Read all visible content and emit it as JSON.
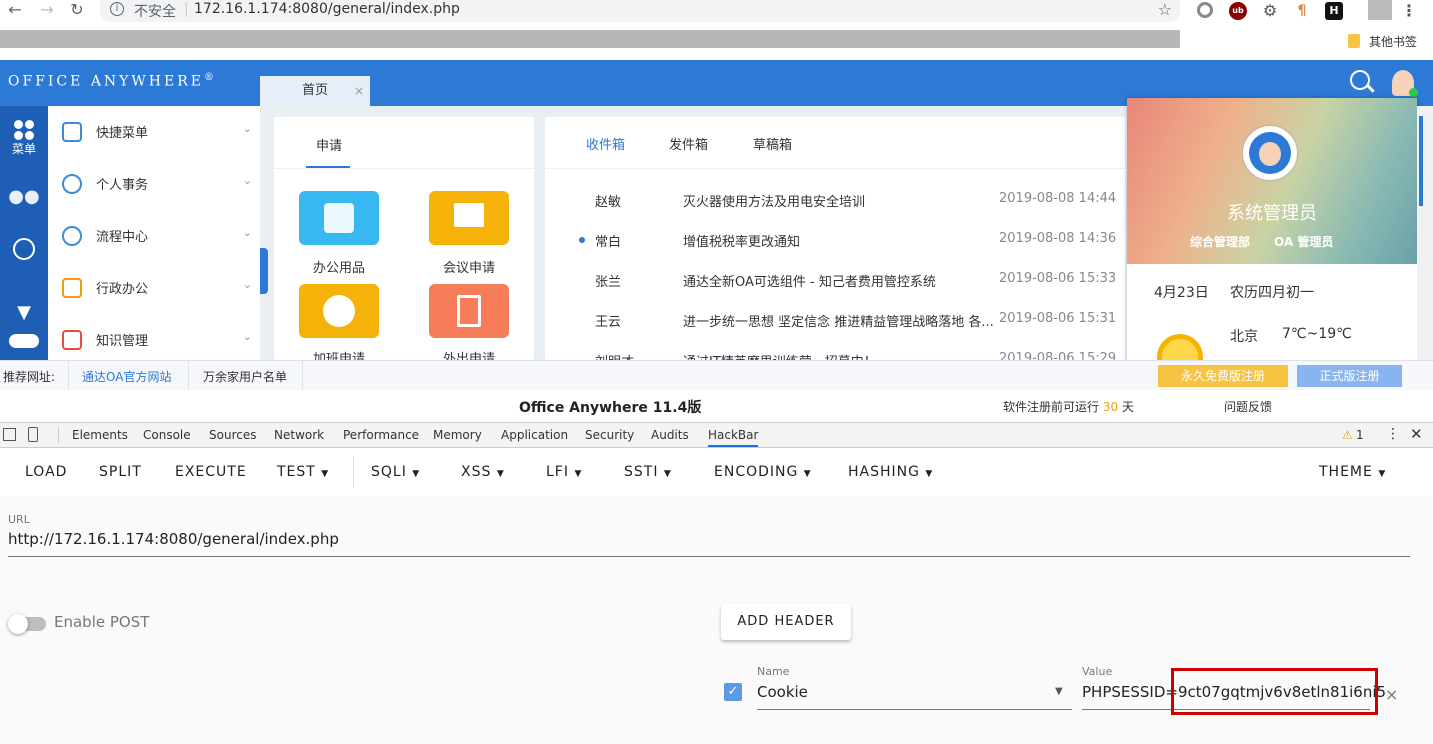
{
  "browser": {
    "url_security": "不安全",
    "url": "172.16.1.174:8080/general/index.php",
    "bookmark_other": "其他书签"
  },
  "oa": {
    "logo": "Office Anywhere",
    "logo_mark": "®",
    "tabs": [
      {
        "label": "首页"
      }
    ],
    "rail": [
      {
        "label": "菜单"
      }
    ],
    "menu": [
      {
        "label": "快捷菜单"
      },
      {
        "label": "个人事务"
      },
      {
        "label": "流程中心"
      },
      {
        "label": "行政办公"
      },
      {
        "label": "知识管理"
      }
    ],
    "apply_panel": {
      "tab": "申请",
      "apps": [
        {
          "label": "办公用品",
          "color": "#37b8f0"
        },
        {
          "label": "会议申请",
          "color": "#f5b30a"
        },
        {
          "label": "加班申请",
          "color": "#f5b30a"
        },
        {
          "label": "外出申请",
          "color": "#f77d5a"
        }
      ]
    },
    "mail_panel": {
      "tabs": [
        "收件箱",
        "发件箱",
        "草稿箱"
      ],
      "rows": [
        {
          "sender": "赵敏",
          "subject": "灭火器使用方法及用电安全培训",
          "time": "2019-08-08 14:44",
          "unread": false
        },
        {
          "sender": "常白",
          "subject": "增值税税率更改通知",
          "time": "2019-08-08 14:36",
          "unread": true
        },
        {
          "sender": "张兰",
          "subject": "通达全新OA可选组件 - 知己者费用管控系统",
          "time": "2019-08-06 15:33",
          "unread": false
        },
        {
          "sender": "王云",
          "subject": "进一步统一思想 坚定信念 推进精益管理战略落地 各...",
          "time": "2019-08-06 15:31",
          "unread": false
        },
        {
          "sender": "刘明才",
          "subject": "通过IT精英磨思训练营，招募中！",
          "time": "2019-08-06 15:29",
          "unread": false
        }
      ]
    },
    "profile": {
      "name": "系统管理员",
      "dept": "综合管理部",
      "role": "OA 管理员",
      "date": "4月23日",
      "lunar": "农历四月初一",
      "city": "北京",
      "temp": "7℃~19℃"
    },
    "footer": {
      "recommend_label": "推荐网址:",
      "links": [
        "通达OA官方网站",
        "万余家用户名单"
      ],
      "free_reg": "永久免费版注册",
      "official_reg": "正式版注册"
    },
    "version": {
      "title": "Office Anywhere 11.4版",
      "trial_prefix": "软件注册前可运行",
      "trial_days": "30",
      "trial_suffix": "天",
      "feedback": "问题反馈"
    }
  },
  "devtools": {
    "tabs": [
      "Elements",
      "Console",
      "Sources",
      "Network",
      "Performance",
      "Memory",
      "Application",
      "Security",
      "Audits",
      "HackBar"
    ],
    "active_tab": "HackBar",
    "warnings": "1"
  },
  "hackbar": {
    "toolbar": [
      "LOAD",
      "SPLIT",
      "EXECUTE",
      "TEST",
      "SQLI",
      "XSS",
      "LFI",
      "SSTI",
      "ENCODING",
      "HASHING"
    ],
    "theme": "THEME",
    "url_label": "URL",
    "url_value": "http://172.16.1.174:8080/general/index.php",
    "enable_post": "Enable POST",
    "add_header": "ADD HEADER",
    "header": {
      "name_label": "Name",
      "name_value": "Cookie",
      "value_label": "Value",
      "value_prefix": "PHPSESSID=",
      "value_highlight": "9ct07gqtmjv6v8etln81i6ni5"
    }
  }
}
